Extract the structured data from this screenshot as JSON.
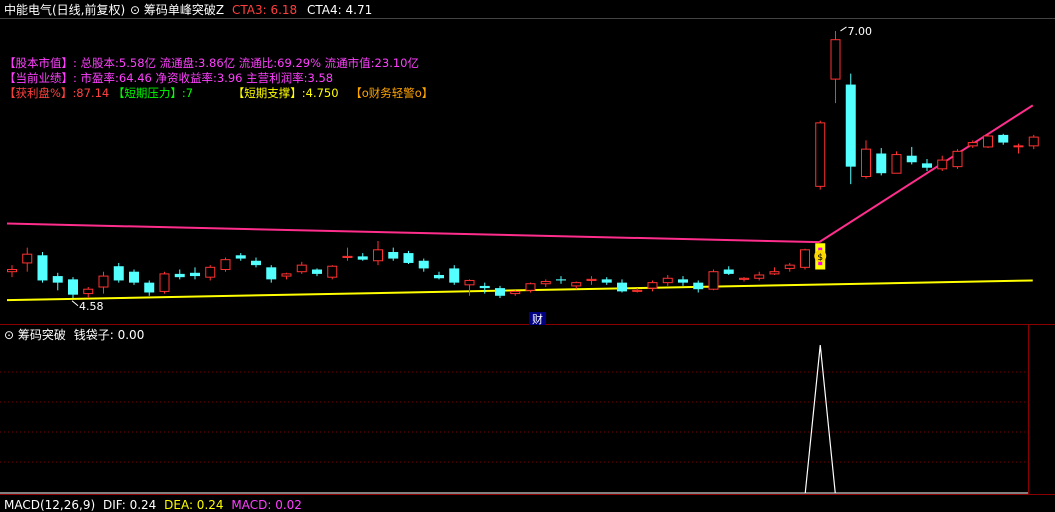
{
  "header": {
    "title": "中能电气(日线,前复权)",
    "indicator_name": "筹码单峰突破Z",
    "cta3_label": "CTA3:",
    "cta3_value": "6.18",
    "cta4_label": "CTA4:",
    "cta4_value": "4.71"
  },
  "info": {
    "line1_label": "【股本市值】:",
    "line1_text": "总股本:5.58亿 流通盘:3.86亿 流通比:69.29% 流通市值:23.10亿",
    "line2_label": "【当前业绩】:",
    "line2_text": "市盈率:64.46 净资收益率:3.96 主营利润率:3.58",
    "line3_a_label": "【获利盘%】",
    "line3_a_value": ":87.14",
    "line3_b_label": "【短期压力】",
    "line3_b_value": ":7",
    "line3_c_label": "【短期支撑】",
    "line3_c_value": ":4.750",
    "line3_d_label": "【o财务轻警o】"
  },
  "annotations": {
    "high_label": "7.00",
    "low_label": "4.58",
    "cai_label": "财",
    "coin_label": "$"
  },
  "panel2": {
    "title": "筹码突破",
    "series_label": "钱袋子:",
    "series_value": "0.00"
  },
  "panel3": {
    "label": "MACD(12,26,9)",
    "dif": "DIF: 0.24",
    "dea": "DEA: 0.24",
    "macd": "MACD: 0.02"
  },
  "colors": {
    "up": "#ff3232",
    "down": "#54ffff",
    "resistance": "#ff2e8c",
    "support": "#ffff00",
    "grid": "#7a0000",
    "label_magenta": "#ff40ff",
    "label_yellow": "#ffff00",
    "label_green": "#00ff00",
    "label_orange": "#ffa500",
    "label_red": "#ff4040"
  },
  "chart_data": {
    "type": "candlestick",
    "ohlc": [
      [
        4.8,
        4.86,
        4.75,
        4.82
      ],
      [
        4.88,
        5.02,
        4.8,
        4.96
      ],
      [
        4.95,
        4.98,
        4.7,
        4.72
      ],
      [
        4.76,
        4.79,
        4.63,
        4.7
      ],
      [
        4.73,
        4.75,
        4.56,
        4.59
      ],
      [
        4.6,
        4.66,
        4.56,
        4.64
      ],
      [
        4.66,
        4.8,
        4.6,
        4.76
      ],
      [
        4.85,
        4.88,
        4.7,
        4.72
      ],
      [
        4.8,
        4.82,
        4.68,
        4.7
      ],
      [
        4.7,
        4.72,
        4.58,
        4.61
      ],
      [
        4.62,
        4.8,
        4.6,
        4.78
      ],
      [
        4.78,
        4.82,
        4.73,
        4.75
      ],
      [
        4.79,
        4.84,
        4.73,
        4.76
      ],
      [
        4.75,
        4.86,
        4.72,
        4.84
      ],
      [
        4.82,
        4.93,
        4.8,
        4.91
      ],
      [
        4.95,
        4.97,
        4.9,
        4.92
      ],
      [
        4.9,
        4.93,
        4.84,
        4.86
      ],
      [
        4.84,
        4.86,
        4.7,
        4.73
      ],
      [
        4.76,
        4.79,
        4.73,
        4.78
      ],
      [
        4.8,
        4.89,
        4.78,
        4.86
      ],
      [
        4.82,
        4.83,
        4.76,
        4.78
      ],
      [
        4.75,
        4.86,
        4.73,
        4.85
      ],
      [
        4.93,
        5.02,
        4.9,
        4.94
      ],
      [
        4.94,
        4.97,
        4.9,
        4.91
      ],
      [
        4.9,
        5.08,
        4.86,
        5.0
      ],
      [
        4.98,
        5.02,
        4.9,
        4.92
      ],
      [
        4.97,
        4.99,
        4.87,
        4.88
      ],
      [
        4.9,
        4.92,
        4.8,
        4.83
      ],
      [
        4.77,
        4.8,
        4.73,
        4.74
      ],
      [
        4.83,
        4.86,
        4.68,
        4.7
      ],
      [
        4.68,
        4.73,
        4.58,
        4.72
      ],
      [
        4.67,
        4.7,
        4.6,
        4.65
      ],
      [
        4.65,
        4.67,
        4.56,
        4.58
      ],
      [
        4.6,
        4.63,
        4.58,
        4.62
      ],
      [
        4.63,
        4.7,
        4.61,
        4.69
      ],
      [
        4.69,
        4.73,
        4.66,
        4.71
      ],
      [
        4.73,
        4.76,
        4.69,
        4.72
      ],
      [
        4.67,
        4.71,
        4.64,
        4.7
      ],
      [
        4.72,
        4.76,
        4.68,
        4.73
      ],
      [
        4.73,
        4.75,
        4.68,
        4.7
      ],
      [
        4.7,
        4.73,
        4.61,
        4.62
      ],
      [
        4.62,
        4.65,
        4.61,
        4.63
      ],
      [
        4.65,
        4.72,
        4.62,
        4.7
      ],
      [
        4.7,
        4.77,
        4.67,
        4.74
      ],
      [
        4.73,
        4.76,
        4.67,
        4.7
      ],
      [
        4.7,
        4.72,
        4.61,
        4.64
      ],
      [
        4.64,
        4.82,
        4.63,
        4.8
      ],
      [
        4.82,
        4.85,
        4.77,
        4.78
      ],
      [
        4.73,
        4.75,
        4.71,
        4.74
      ],
      [
        4.74,
        4.8,
        4.72,
        4.77
      ],
      [
        4.78,
        4.84,
        4.77,
        4.8
      ],
      [
        4.83,
        4.88,
        4.8,
        4.86
      ],
      [
        4.84,
        5.01,
        4.82,
        5.0
      ],
      [
        5.58,
        6.18,
        5.55,
        6.16
      ],
      [
        6.56,
        7.0,
        6.34,
        6.92
      ],
      [
        6.51,
        6.61,
        5.6,
        5.76
      ],
      [
        5.67,
        6.0,
        5.65,
        5.92
      ],
      [
        5.88,
        5.93,
        5.68,
        5.7
      ],
      [
        5.7,
        5.9,
        5.7,
        5.87
      ],
      [
        5.86,
        5.94,
        5.78,
        5.8
      ],
      [
        5.79,
        5.83,
        5.72,
        5.75
      ],
      [
        5.74,
        5.86,
        5.72,
        5.82
      ],
      [
        5.76,
        5.92,
        5.74,
        5.9
      ],
      [
        5.95,
        6.0,
        5.93,
        5.98
      ],
      [
        5.94,
        6.05,
        5.93,
        6.04
      ],
      [
        6.05,
        6.06,
        5.96,
        5.98
      ],
      [
        5.95,
        5.97,
        5.88,
        5.95
      ],
      [
        5.95,
        6.05,
        5.92,
        6.03
      ]
    ],
    "price_range": [
      4.45,
      7.1
    ],
    "resistance": [
      [
        0,
        5.24
      ],
      [
        53,
        5.07
      ]
    ],
    "resistance_rise": [
      [
        53,
        5.07
      ],
      [
        67,
        6.32
      ]
    ],
    "support": [
      [
        0,
        4.54
      ],
      [
        67,
        4.72
      ]
    ],
    "signal_bar": 53,
    "lower_signal": {
      "index": 53,
      "peak": 1.0
    },
    "xlabel": "",
    "ylabel": ""
  }
}
